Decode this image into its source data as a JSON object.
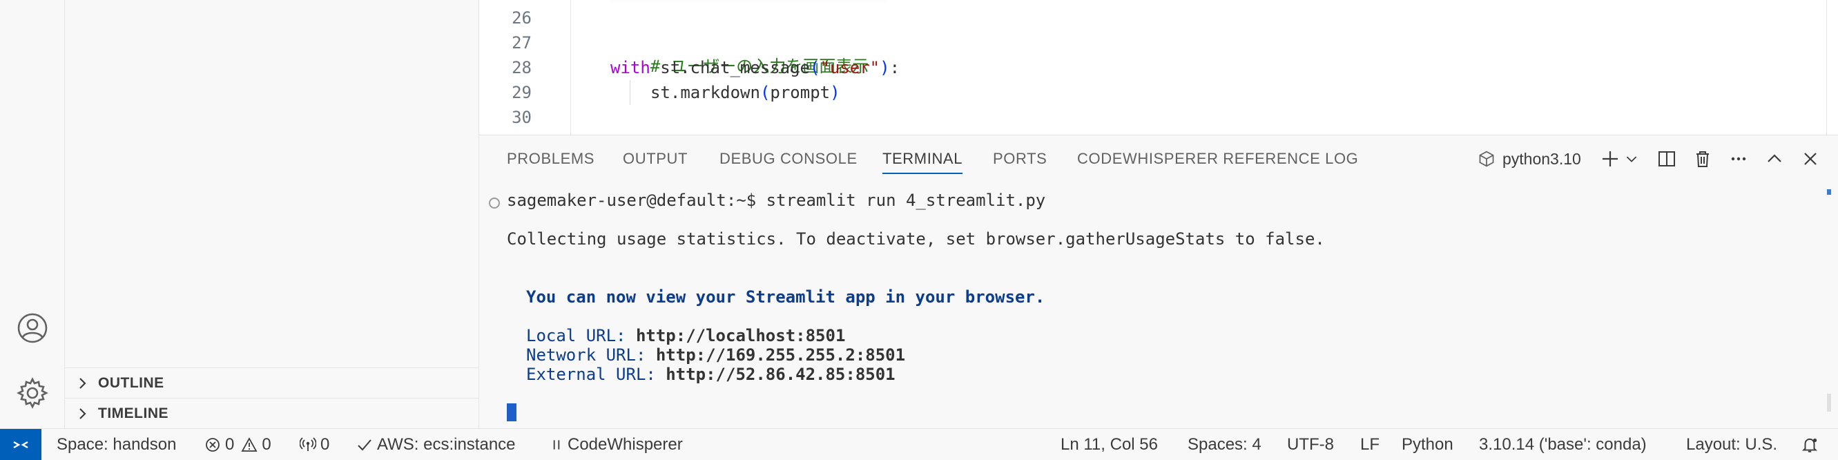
{
  "activity_bar": {
    "icons": [
      "account-icon",
      "gear-icon"
    ]
  },
  "side_bar": {
    "sections": [
      {
        "label": "OUTLINE"
      },
      {
        "label": "TIMELINE"
      }
    ]
  },
  "editor": {
    "lines": [
      {
        "number": "26",
        "text": ""
      },
      {
        "number": "27",
        "comment": "# ユーザーの入力を画面表示"
      },
      {
        "number": "28",
        "kw": "with",
        "pre": " st.chat_message",
        "open": "(",
        "str": "\"user\"",
        "close": ")",
        "post": ":"
      },
      {
        "number": "29",
        "pre": "st.markdown",
        "open": "(",
        "arg": "prompt",
        "close": ")"
      },
      {
        "number": "30",
        "text": ""
      }
    ]
  },
  "panel": {
    "tabs": [
      {
        "label": "PROBLEMS",
        "active": false
      },
      {
        "label": "OUTPUT",
        "active": false
      },
      {
        "label": "DEBUG CONSOLE",
        "active": false
      },
      {
        "label": "TERMINAL",
        "active": true
      },
      {
        "label": "PORTS",
        "active": false
      },
      {
        "label": "CODEWHISPERER REFERENCE LOG",
        "active": false
      }
    ],
    "terminal_profile": "python3.10"
  },
  "terminal": {
    "prompt": "sagemaker-user@default:~$ streamlit run 4_streamlit.py",
    "usage_stats": "Collecting usage statistics. To deactivate, set browser.gatherUsageStats to false.",
    "view_msg": "You can now view your Streamlit app in your browser.",
    "urls": [
      {
        "label": "Local URL: ",
        "value": "http://localhost:8501"
      },
      {
        "label": "Network URL: ",
        "value": "http://169.255.255.2:8501"
      },
      {
        "label": "External URL: ",
        "value": "http://52.86.42.85:8501"
      }
    ]
  },
  "status_bar": {
    "space": "Space: handson",
    "errors": "0",
    "warnings": "0",
    "ports": "0",
    "aws": "AWS: ecs:instance",
    "codewhisperer": "CodeWhisperer",
    "cursor": "Ln 11, Col 56",
    "spaces": "Spaces: 4",
    "encoding": "UTF-8",
    "eol": "LF",
    "language": "Python",
    "interpreter": "3.10.14 ('base': conda)",
    "layout": "Layout: U.S."
  },
  "colors": {
    "accent": "#005fb8",
    "terminal_blue": "#0c3c8c"
  }
}
